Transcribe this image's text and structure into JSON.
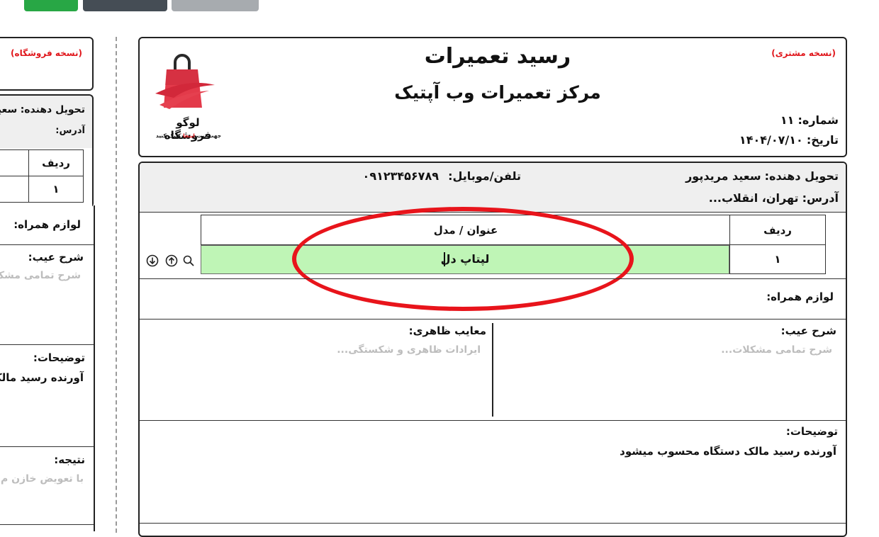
{
  "toolbar": {
    "btn_green": "",
    "btn_dark": "",
    "btn_gray": "",
    "top_link": ""
  },
  "receipt": {
    "copy_label": "(نسخه مشتری)",
    "title": "رسید تعمیرات",
    "subtitle": "مرکز تعمیرات وب آپتیک",
    "number_label": "شماره:",
    "number_value": "۱۱",
    "date_label": "تاریخ:",
    "date_value": "۱۴۰۴/۰۷/۱۰",
    "logo_title": "لوگو فروشگاه",
    "logo_caption_1": "جهت ثبت",
    "logo_caption_link": "اینجا",
    "logo_caption_2": "کلیک کنید",
    "deliverer_label": "تحویل دهنده:",
    "deliverer_value": "سعید مریدپور",
    "phone_label": "تلفن/موبایل:",
    "phone_value": "۰۹۱۲۳۴۵۶۷۸۹",
    "address_label": "آدرس:",
    "address_value": "تهران، انقلاب...",
    "table": {
      "col_row": "ردیف",
      "col_title": "عنوان / مدل",
      "rows": [
        {
          "index": "۱",
          "title": "لپتاپ دل"
        }
      ]
    },
    "accessories_label": "لوازم همراه:",
    "defect_label": "شرح عیب:",
    "defect_placeholder": "شرح تمامی مشکلات...",
    "appearance_label": "معایب ظاهری:",
    "appearance_placeholder": "ایرادات ظاهری و شکستگی...",
    "notes_label": "توضیحات:",
    "notes_value": "آورنده رسید مالک دستگاه محسوب میشود"
  },
  "store_copy": {
    "copy_label": "(نسخه فروشگاه)",
    "deliverer_label": "تحویل دهنده:",
    "deliverer_value": "سعید",
    "address_label": "آدرس:",
    "col_row": "ردیف",
    "row_index": "۱",
    "accessories_label": "لوازم همراه:",
    "defect_label": "شرح عیب:",
    "defect_placeholder": "شرح تمامی مشک",
    "notes_label": "توضیحات:",
    "notes_value": "آورنده رسید مالک",
    "result_label": "نتیجه:",
    "result_placeholder": "با تعویض خازن م"
  },
  "colors": {
    "accent_red": "#e0161b",
    "input_green": "#bff5b6",
    "logo_red": "#e33a4a"
  },
  "icons": [
    "search-icon",
    "arrow-up-circle-icon",
    "arrow-down-circle-icon",
    "shopping-bag-logo-icon"
  ]
}
